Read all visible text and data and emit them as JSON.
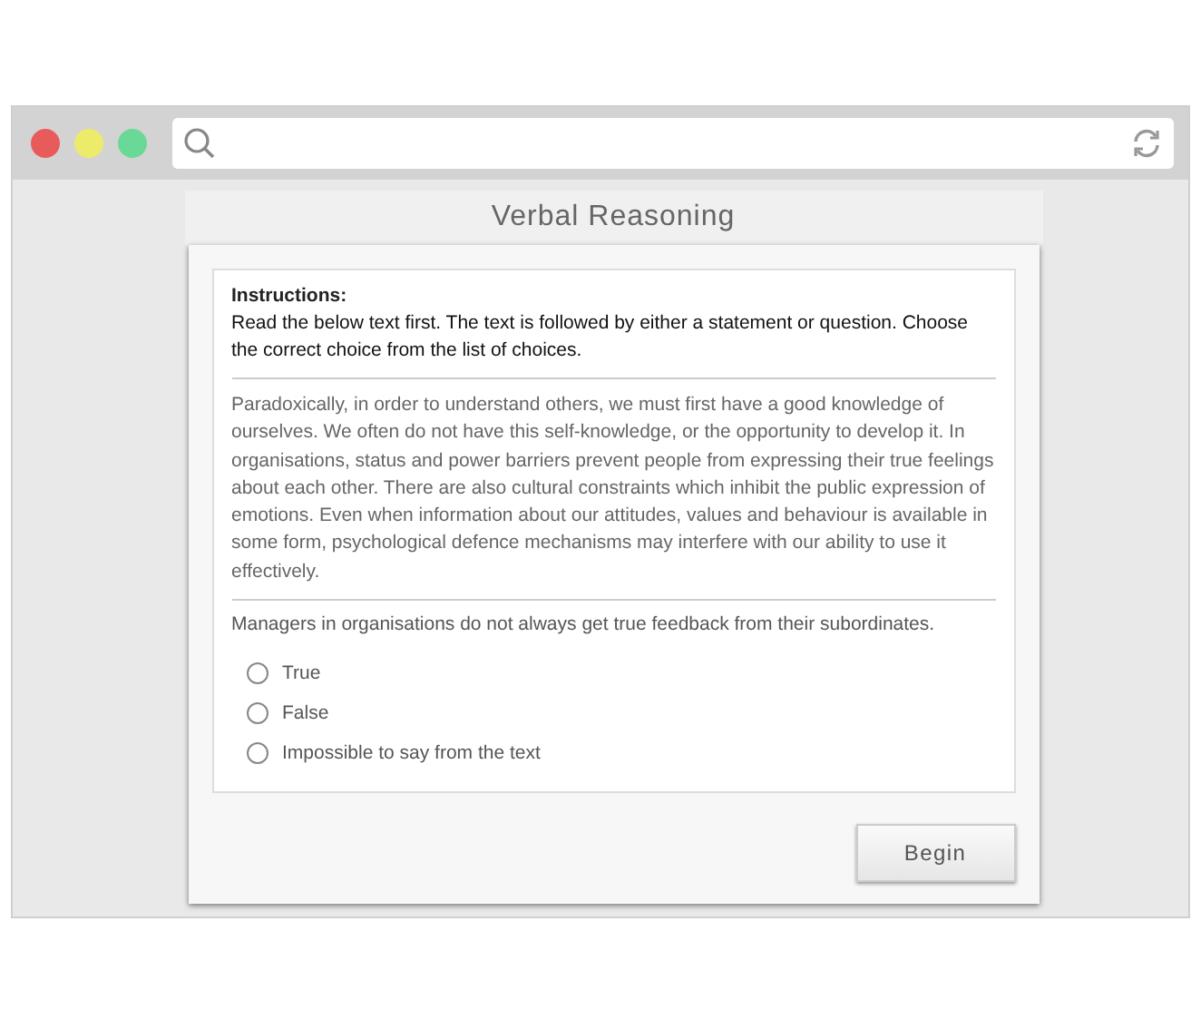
{
  "title": "Verbal Reasoning",
  "instructions": {
    "heading": "Instructions:",
    "text": "Read the below text first. The text is followed by either a statement or question. Choose the correct choice from the list of choices."
  },
  "passage": "Paradoxically, in order to understand others, we must first have a good knowledge of ourselves. We often do not have this self-knowledge, or the opportunity to develop it. In organisations, status and power barriers prevent people from expressing their true feelings about each other. There are also cultural constraints which inhibit the public expression of emotions. Even when information about our attitudes, values and behaviour is available in some form, psychological defence mechanisms may interfere with our ability to use it effectively.",
  "statement": "Managers in organisations do not always get true feedback from their subordinates.",
  "choices": [
    {
      "label": "True",
      "selected": false
    },
    {
      "label": "False",
      "selected": false
    },
    {
      "label": "Impossible to say from the text",
      "selected": false
    }
  ],
  "button": "Begin"
}
